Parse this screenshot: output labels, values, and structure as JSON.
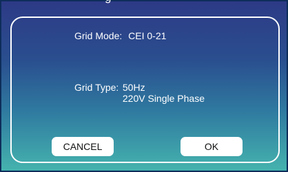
{
  "window": {
    "title_fragment": "g"
  },
  "dialog": {
    "grid_mode": {
      "label": "Grid Mode:",
      "value": "CEI 0-21"
    },
    "grid_type": {
      "label": "Grid Type:",
      "frequency": "50Hz",
      "phase": "220V Single Phase"
    },
    "buttons": {
      "cancel": "CANCEL",
      "ok": "OK"
    }
  },
  "colors": {
    "gradient_top": "#2d3a86",
    "gradient_bottom": "#45b3ae",
    "frame": "#ffffff"
  }
}
